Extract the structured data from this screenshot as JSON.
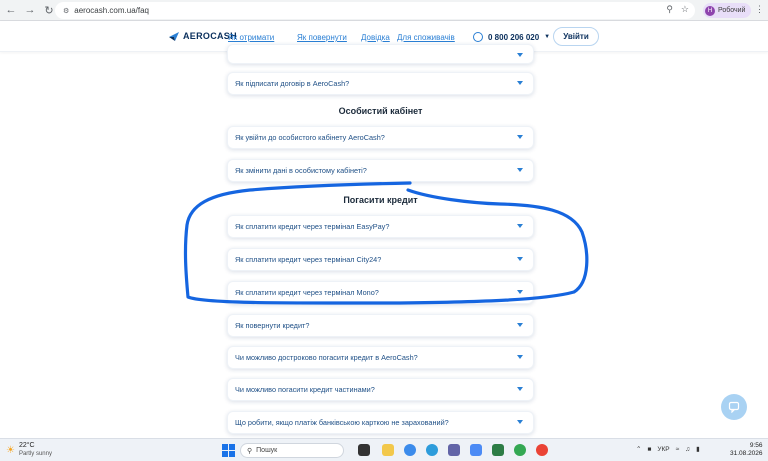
{
  "browser": {
    "url": "aerocash.com.ua/faq",
    "profile_label": "Робочий",
    "profile_initial": "Н"
  },
  "header": {
    "logo_text": "AEROCASH",
    "nav": [
      "Як отримати",
      "Як повернути",
      "Довідка",
      "Для споживачів"
    ],
    "phone": "0 800 206 020",
    "login_label": "Увійти"
  },
  "faq": {
    "top_items": [
      "Як підписати договір в AeroCash?"
    ],
    "sections": [
      {
        "title": "Особистий кабінет",
        "items": [
          "Як увійти до особистого кабінету AeroCash?",
          "Як змінити дані в особистому кабінеті?"
        ]
      },
      {
        "title": "Погасити кредит",
        "items": [
          "Як сплатити кредит через термінал EasyPay?",
          "Як сплатити кредит через термінал City24?",
          "Як сплатити кредит через термінал Mono?",
          "Як повернути кредит?",
          "Чи можливо достроково погасити кредит в AeroCash?",
          "Чи можливо погасити кредит частинами?",
          "Що робити, якщо платіж банківською карткою не зарахований?"
        ]
      }
    ]
  },
  "taskbar": {
    "weather_temp": "22°C",
    "weather_desc": "Partly sunny",
    "search_label": "Пошук",
    "lang": "УКР",
    "time": "9:56",
    "date": "31.08.2026"
  },
  "colors": {
    "accent": "#2a7fd4",
    "brand_dark": "#0a2f5c",
    "annotation": "#1565e0"
  }
}
